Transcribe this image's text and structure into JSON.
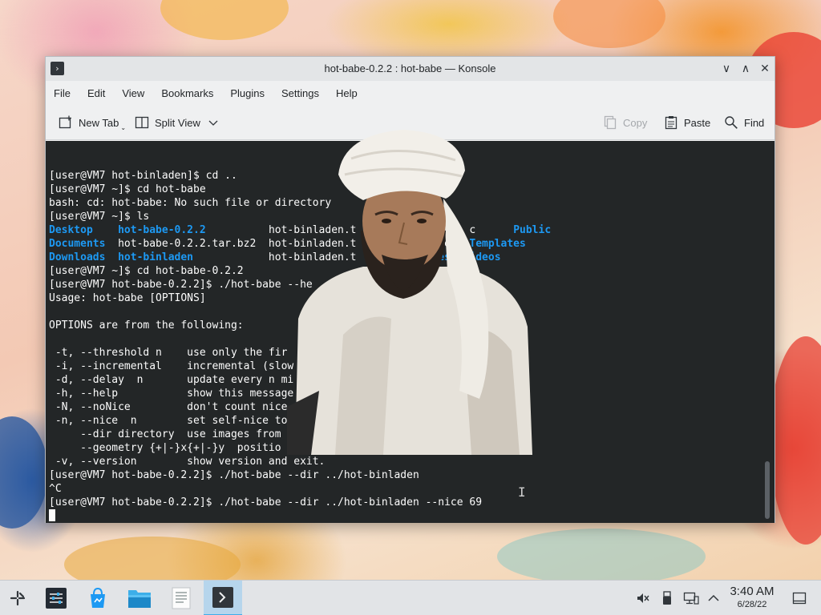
{
  "window": {
    "title": "hot-babe-0.2.2 : hot-babe — Konsole",
    "app_icon": "terminal-icon",
    "controls": {
      "minimize": "∨",
      "maximize": "∧",
      "close": "✕"
    }
  },
  "menubar": [
    "File",
    "Edit",
    "View",
    "Bookmarks",
    "Plugins",
    "Settings",
    "Help"
  ],
  "toolbar": {
    "new_tab": "New Tab",
    "split_view": "Split View",
    "copy": "Copy",
    "paste": "Paste",
    "find": "Find"
  },
  "terminal": {
    "lines": [
      {
        "parts": [
          {
            "t": "[user@VM7 hot-binladen]$ cd .."
          }
        ]
      },
      {
        "parts": [
          {
            "t": "[user@VM7 ~]$ cd hot-babe"
          }
        ]
      },
      {
        "parts": [
          {
            "t": "bash: cd: hot-babe: No such file or directory"
          }
        ]
      },
      {
        "parts": [
          {
            "t": "[user@VM7 ~]$ ls"
          }
        ]
      },
      {
        "parts": [
          {
            "t": "Desktop    ",
            "c": "blue"
          },
          {
            "t": "hot-babe-0.2.2",
            "c": "blue"
          },
          {
            "t": "          hot-binladen.t"
          },
          {
            "t": "                  c      "
          },
          {
            "t": "Public",
            "c": "blue"
          }
        ]
      },
      {
        "parts": [
          {
            "t": "Documents  ",
            "c": "blue"
          },
          {
            "t": "hot-babe-0.2.2.tar.bz2  hot-binladen.t           s.pem  "
          },
          {
            "t": "Templates",
            "c": "blue"
          }
        ]
      },
      {
        "parts": [
          {
            "t": "Downloads  ",
            "c": "blue"
          },
          {
            "t": "hot-binladen",
            "c": "blue"
          },
          {
            "t": "            hot-binladen.t           "
          },
          {
            "t": "ures  ",
            "c": "blue"
          },
          {
            "t": "Videos",
            "c": "blue"
          }
        ]
      },
      {
        "parts": [
          {
            "t": "[user@VM7 ~]$ cd hot-babe-0.2.2"
          }
        ]
      },
      {
        "parts": [
          {
            "t": "[user@VM7 hot-babe-0.2.2]$ ./hot-babe --he"
          }
        ]
      },
      {
        "parts": [
          {
            "t": "Usage: hot-babe [OPTIONS]"
          }
        ]
      },
      {
        "parts": [
          {
            "t": ""
          }
        ]
      },
      {
        "parts": [
          {
            "t": "OPTIONS are from the following:"
          }
        ]
      },
      {
        "parts": [
          {
            "t": ""
          }
        ]
      },
      {
        "parts": [
          {
            "t": " -t, --threshold n    use only the fir"
          }
        ]
      },
      {
        "parts": [
          {
            "t": " -i, --incremental    incremental (slow"
          }
        ]
      },
      {
        "parts": [
          {
            "t": " -d, --delay  n       update every n mi"
          }
        ]
      },
      {
        "parts": [
          {
            "t": " -h, --help           show this message"
          }
        ]
      },
      {
        "parts": [
          {
            "t": " -N, --noNice         don't count nice"
          }
        ]
      },
      {
        "parts": [
          {
            "t": " -n, --nice  n        set self-nice to"
          }
        ]
      },
      {
        "parts": [
          {
            "t": "     --dir directory  use images from"
          }
        ]
      },
      {
        "parts": [
          {
            "t": "     --geometry {+|-}x{+|-}y  positio"
          }
        ]
      },
      {
        "parts": [
          {
            "t": " -v, --version        show version and exit."
          }
        ]
      },
      {
        "parts": [
          {
            "t": "[user@VM7 hot-babe-0.2.2]$ ./hot-babe --dir ../hot-binladen"
          }
        ]
      },
      {
        "parts": [
          {
            "t": "^C"
          }
        ]
      },
      {
        "parts": [
          {
            "t": "[user@VM7 hot-babe-0.2.2]$ ./hot-babe --dir ../hot-binladen --nice 69"
          }
        ]
      }
    ]
  },
  "taskbar": {
    "apps": [
      "application-launcher-icon",
      "system-settings-icon",
      "discover-icon",
      "dolphin-icon",
      "text-editor-icon",
      "konsole-icon"
    ],
    "tray": [
      "volume-muted-icon",
      "usb-icon",
      "network-icon",
      "chevron-up-icon"
    ],
    "clock": {
      "time": "3:40 AM",
      "date": "6/28/22"
    },
    "show_desktop": "show-desktop-icon"
  }
}
